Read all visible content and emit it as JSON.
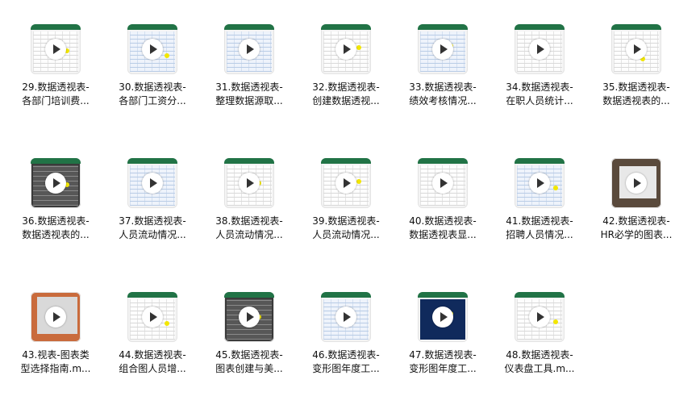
{
  "files": [
    {
      "line1": "29.数据透视表-",
      "line2": "各部门培训费...",
      "thumb": "excel-green"
    },
    {
      "line1": "30.数据透视表-",
      "line2": "各部门工资分...",
      "thumb": "excel-blue"
    },
    {
      "line1": "31.数据透视表-",
      "line2": "整理数据源取...",
      "thumb": "excel-blue"
    },
    {
      "line1": "32.数据透视表-",
      "line2": "创建数据透视...",
      "thumb": "excel-green"
    },
    {
      "line1": "33.数据透视表-",
      "line2": "绩效考核情况...",
      "thumb": "excel-blue"
    },
    {
      "line1": "34.数据透视表-",
      "line2": "在职人员统计...",
      "thumb": "excel-green"
    },
    {
      "line1": "35.数据透视表-",
      "line2": "数据透视表的...",
      "thumb": "excel-green"
    },
    {
      "line1": "36.数据透视表-",
      "line2": "数据透视表的...",
      "thumb": "excel-dark"
    },
    {
      "line1": "37.数据透视表-",
      "line2": "人员流动情况...",
      "thumb": "excel-blue"
    },
    {
      "line1": "38.数据透视表-",
      "line2": "人员流动情况...",
      "thumb": "excel-green"
    },
    {
      "line1": "39.数据透视表-",
      "line2": "人员流动情况...",
      "thumb": "excel-green"
    },
    {
      "line1": "40.数据透视表-",
      "line2": "数据透视表显...",
      "thumb": "excel-green"
    },
    {
      "line1": "41.数据透视表-",
      "line2": "招聘人员情况...",
      "thumb": "excel-blue"
    },
    {
      "line1": "42.数据透视表-",
      "line2": "HR必学的图表...",
      "thumb": "photo"
    },
    {
      "line1": "43.视表-图表类",
      "line2": "型选择指南.m...",
      "thumb": "warm"
    },
    {
      "line1": "44.数据透视表-",
      "line2": "组合图人员增...",
      "thumb": "excel-green"
    },
    {
      "line1": "45.数据透视表-",
      "line2": "图表创建与美...",
      "thumb": "excel-dark"
    },
    {
      "line1": "46.数据透视表-",
      "line2": "变形图年度工...",
      "thumb": "excel-blue"
    },
    {
      "line1": "47.数据透视表-",
      "line2": "变形图年度工...",
      "thumb": "excel-navy"
    },
    {
      "line1": "48.数据透视表-",
      "line2": "仪表盘工具.m...",
      "thumb": "excel-green"
    }
  ],
  "colors": {
    "excel_green": "#217346",
    "highlight_dot": "#f2e600"
  }
}
